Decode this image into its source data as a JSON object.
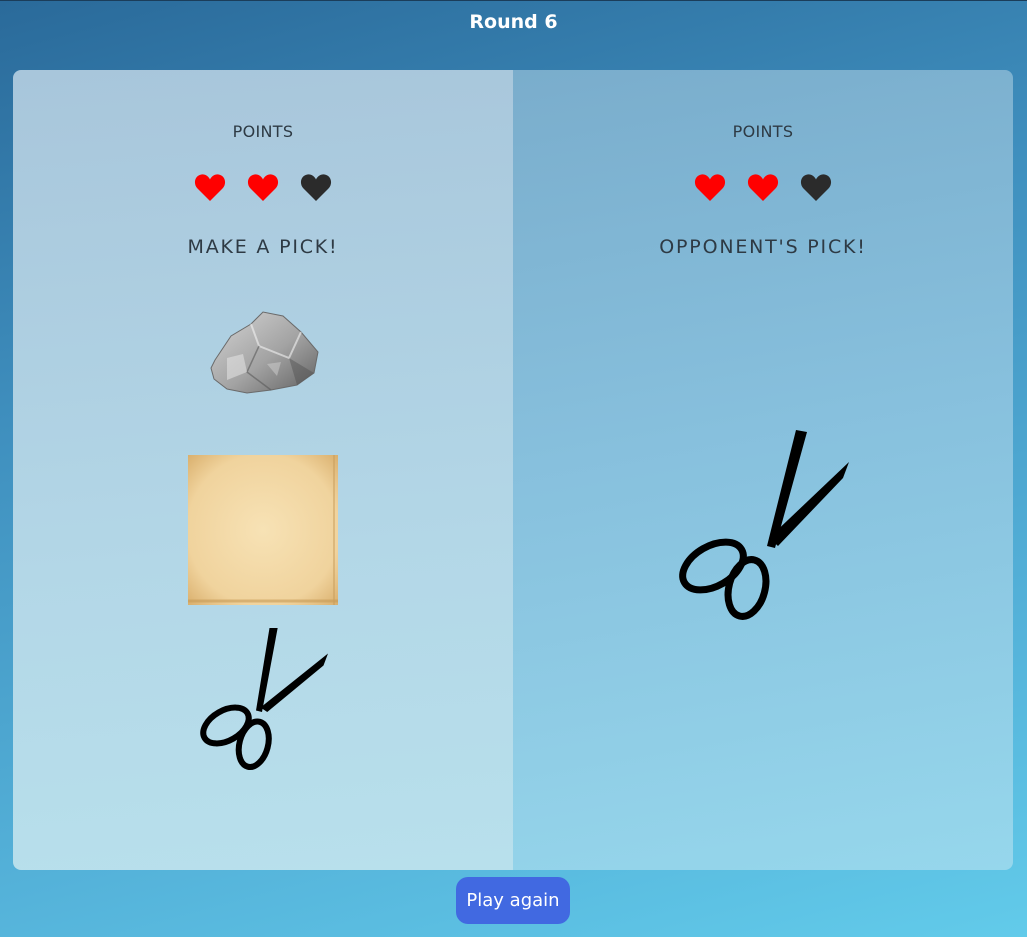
{
  "header": {
    "title": "Round 6"
  },
  "player": {
    "points_label": "POINTS",
    "pick_prompt": "MAKE A PICK!",
    "lives": {
      "remaining": 2,
      "total": 3
    },
    "choices": [
      {
        "label": "rock",
        "icon": "rock-icon"
      },
      {
        "label": "paper",
        "icon": "paper-icon"
      },
      {
        "label": "scissors",
        "icon": "scissors-icon"
      }
    ]
  },
  "opponent": {
    "points_label": "POINTS",
    "pick_label": "OPPONENT'S PICK!",
    "lives": {
      "remaining": 2,
      "total": 3
    },
    "pick": {
      "label": "scissors",
      "icon": "scissors-icon"
    }
  },
  "footer": {
    "play_again_label": "Play again"
  },
  "colors": {
    "heart_full": "#ff0000",
    "heart_empty": "#2b2b2b",
    "button": "#4169e1",
    "background_top": "#2a6a9a",
    "background_bottom": "#62cbea"
  }
}
